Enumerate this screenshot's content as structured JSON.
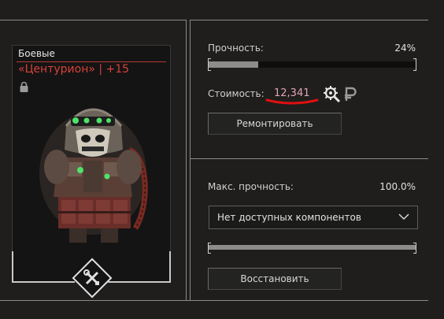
{
  "item": {
    "category": "Боевые",
    "name": "«Центурион» | +15",
    "locked_icon": "lock-icon",
    "repair_badge_icon": "wrench-screwdriver-icon"
  },
  "repair": {
    "durability_label": "Прочность:",
    "durability_value": "24%",
    "durability_fraction": 0.24,
    "cost_label": "Стоимость:",
    "cost_value": "12,341",
    "cost_icons": [
      "gear-search-icon",
      "ruble-icon"
    ],
    "repair_button": "Ремонтировать"
  },
  "restore": {
    "max_durability_label": "Макс. прочность:",
    "max_durability_value": "100.0%",
    "component_select": "Нет доступных компонентов",
    "restore_button": "Восстановить"
  },
  "colors": {
    "accent_red": "#d8413a",
    "cost_pink": "#e3a3b8",
    "annotation_red": "#e01010"
  }
}
